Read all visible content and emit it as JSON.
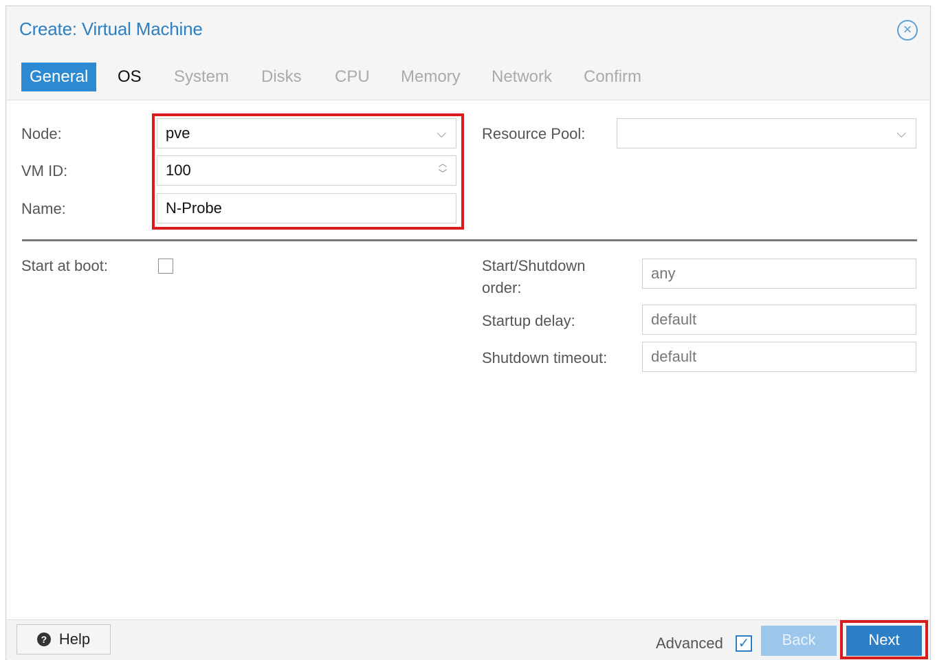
{
  "dialog": {
    "title": "Create: Virtual Machine",
    "close_icon": "close-icon"
  },
  "tabs": [
    {
      "label": "General",
      "state": "active"
    },
    {
      "label": "OS",
      "state": "enabled"
    },
    {
      "label": "System",
      "state": "disabled"
    },
    {
      "label": "Disks",
      "state": "disabled"
    },
    {
      "label": "CPU",
      "state": "disabled"
    },
    {
      "label": "Memory",
      "state": "disabled"
    },
    {
      "label": "Network",
      "state": "disabled"
    },
    {
      "label": "Confirm",
      "state": "disabled"
    }
  ],
  "form": {
    "node": {
      "label": "Node:",
      "value": "pve"
    },
    "vmid": {
      "label": "VM ID:",
      "value": "100"
    },
    "name": {
      "label": "Name:",
      "value": "N-Probe"
    },
    "resource_pool": {
      "label": "Resource Pool:",
      "value": ""
    },
    "start_at_boot": {
      "label": "Start at boot:",
      "checked": false
    },
    "start_shutdown_order": {
      "label_line1": "Start/Shutdown",
      "label_line2": "order:",
      "placeholder": "any"
    },
    "startup_delay": {
      "label": "Startup delay:",
      "placeholder": "default"
    },
    "shutdown_timeout": {
      "label": "Shutdown timeout:",
      "placeholder": "default"
    }
  },
  "footer": {
    "help_label": "Help",
    "advanced_label": "Advanced",
    "advanced_checked": true,
    "back_label": "Back",
    "next_label": "Next"
  },
  "colors": {
    "accent": "#2c7fc4",
    "highlight_box": "#d81b1b"
  }
}
